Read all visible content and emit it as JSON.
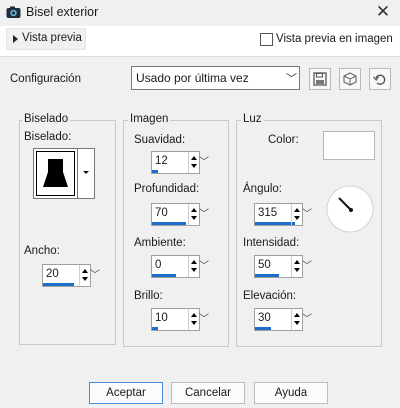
{
  "window": {
    "title": "Bisel exterior"
  },
  "preview": {
    "toggle_label": "Vista previa",
    "check_label": "Vista previa en imagen",
    "checked": false
  },
  "config": {
    "label": "Configuración",
    "selected": "Usado por última vez"
  },
  "bisel": {
    "group_title": "Biselado",
    "shape_label": "Biselado:",
    "ancho": {
      "label": "Ancho:",
      "value": "20",
      "fill": 0.65
    }
  },
  "imagen": {
    "group_title": "Imagen",
    "suavidad": {
      "label": "Suavidad:",
      "value": "12",
      "fill": 0.12
    },
    "profundidad": {
      "label": "Profundidad:",
      "value": "70",
      "fill": 0.72
    },
    "ambiente": {
      "label": "Ambiente:",
      "value": "0",
      "fill": 0.52
    },
    "brillo": {
      "label": "Brillo:",
      "value": "10",
      "fill": 0.12
    }
  },
  "luz": {
    "group_title": "Luz",
    "color_label": "Color:",
    "color_value": "#ffffff",
    "angulo": {
      "label": "Ángulo:",
      "value": "315",
      "fill": 0.85
    },
    "intensidad": {
      "label": "Intensidad:",
      "value": "50",
      "fill": 0.5
    },
    "elevacion": {
      "label": "Elevación:",
      "value": "30",
      "fill": 0.33
    }
  },
  "buttons": {
    "accept": "Aceptar",
    "cancel": "Cancelar",
    "help": "Ayuda"
  },
  "icons": {
    "app": "camera-icon",
    "close": "close-icon",
    "save": "floppy-disk-icon",
    "delete": "cube-delete-icon",
    "reset": "reset-icon"
  },
  "accent_color": "#1a6fc9"
}
